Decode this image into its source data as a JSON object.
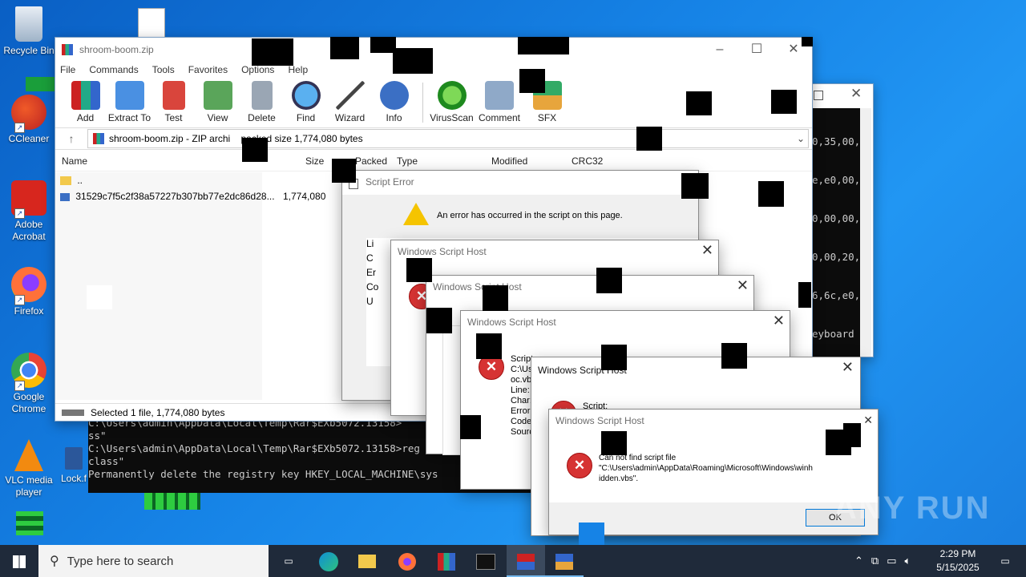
{
  "desktop": {
    "icons": [
      {
        "label": "Recycle Bin"
      },
      {
        "label": "CCleaner"
      },
      {
        "label": "Adobe Acrobat"
      },
      {
        "label": "Firefox"
      },
      {
        "label": "Google Chrome"
      },
      {
        "label": "VLC media player"
      },
      {
        "label": "Lock.f"
      }
    ]
  },
  "winrar": {
    "title": "shroom-boom.zip",
    "menu": [
      "File",
      "Commands",
      "Tools",
      "Favorites",
      "Options",
      "Help"
    ],
    "toolbar": [
      "Add",
      "Extract To",
      "Test",
      "View",
      "Delete",
      "Find",
      "Wizard",
      "Info",
      "VirusScan",
      "Comment",
      "SFX"
    ],
    "address": "shroom-boom.zip - ZIP archi    packed size 1,774,080 bytes",
    "columns": [
      "Name",
      "Size",
      "Packed",
      "Type",
      "Modified",
      "CRC32"
    ],
    "rows": [
      {
        "name": "..",
        "size": ""
      },
      {
        "name": "31529c7f5c2f38a57227b307bb77e2dc86d28...",
        "size": "1,774,080"
      }
    ],
    "status": "Selected 1 file, 1,774,080 bytes"
  },
  "console_right": {
    "lines": [
      "0,35,00,",
      "e,e0,00,",
      "0,00,00,",
      "0,00,20,",
      "6,6c,e0,",
      "eyboard"
    ]
  },
  "console_bottom": {
    "lines": [
      "C:\\Users\\admin\\AppData\\Local\\Temp\\Rar$EXb5072.13158>",
      "ss\"",
      "",
      "C:\\Users\\admin\\AppData\\Local\\Temp\\Rar$EXb5072.13158>reg de",
      "class\"",
      "Permanently delete the registry key HKEY_LOCAL_MACHINE\\sys"
    ]
  },
  "script_error": {
    "title": "Script Error",
    "message": "An error has occurred in the script on this page.",
    "side_labels": [
      "Li",
      "C",
      "Er",
      "Co",
      "U"
    ]
  },
  "wsh_dialogs": [
    {
      "title": "Windows Script Host"
    },
    {
      "title": "Windows Script Host"
    },
    {
      "title": "Windows Script Host",
      "lines": [
        "Script",
        "C:\\Us",
        "oc.vb",
        "Line:",
        "Char:",
        "Error",
        "Code",
        "Sourc"
      ]
    },
    {
      "title": "Windows Script Host",
      "script_label": "Script:"
    }
  ],
  "final_dialog": {
    "title": "Windows Script Host",
    "message_line1": "Can not find script file",
    "message_line2": "\"C:\\Users\\admin\\AppData\\Roaming\\Microsoft\\Windows\\winh",
    "message_line3": "idden.vbs\".",
    "ok_label": "OK"
  },
  "watermark": "ANY RUN",
  "taskbar": {
    "search_placeholder": "Type here to search",
    "time": "2:29 PM",
    "date": "5/15/2025"
  },
  "colors": {
    "accent": "#0078d7",
    "error": "#d63333",
    "taskbar": "#1f2a3a"
  }
}
